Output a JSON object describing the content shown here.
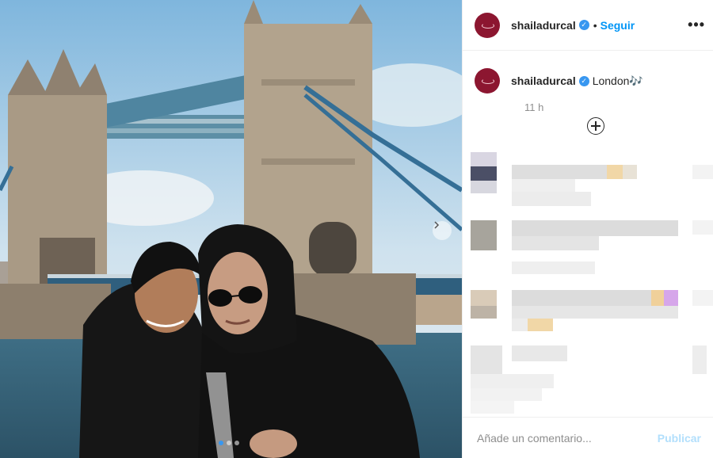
{
  "post": {
    "username": "shailadurcal",
    "verified_glyph": "✓",
    "bullet": "•",
    "follow_label": "Seguir",
    "more_glyph": "•••",
    "caption": "London🎶",
    "time": "11 h",
    "image_index": 1,
    "image_count": 3
  },
  "comment_box": {
    "placeholder": "Añade un comentario...",
    "publish_label": "Publicar"
  },
  "icons": [
    "avatar",
    "verified-badge-icon",
    "more-options-icon",
    "load-more-comments-icon",
    "next-image-icon"
  ],
  "colors": {
    "accent": "#0095f6",
    "publish_disabled": "#b2dffc",
    "secondary_text": "#8e8e8e",
    "border": "#efefef"
  }
}
